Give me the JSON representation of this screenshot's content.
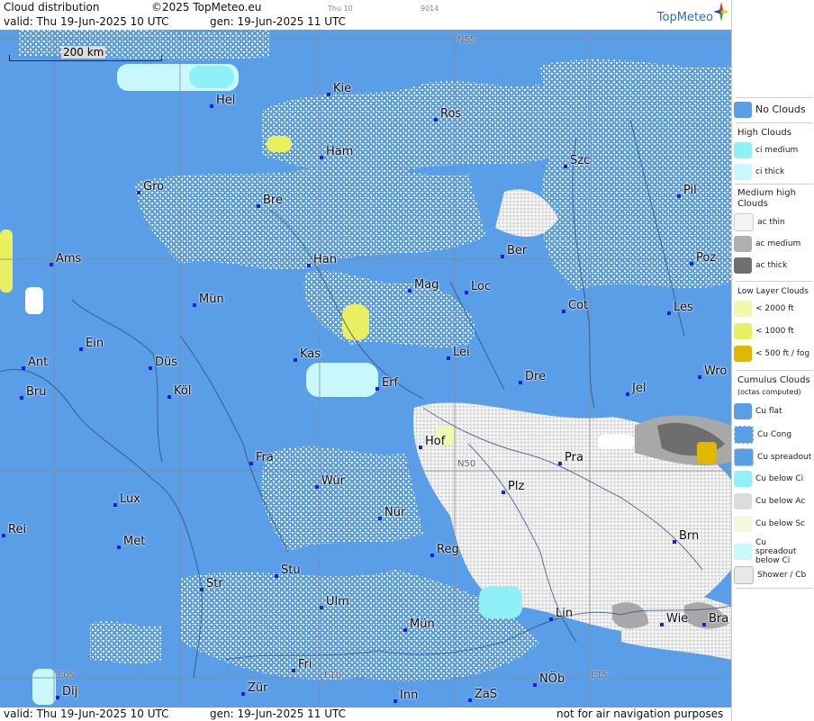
{
  "header": {
    "title": "Cloud distribution",
    "copyright": "©2025 TopMeteo.eu",
    "valid": "valid:  Thu  19-Jun-2025  10 UTC",
    "gen": "gen: 19-Jun-2025 11 UTC",
    "faint1": "Thu 10",
    "faint2": "9014",
    "brand": "TopMeteo"
  },
  "footer": {
    "valid": "valid:  Thu  19-Jun-2025  10 UTC",
    "gen": "gen: 19-Jun-2025 11 UTC",
    "note": "not for air navigation purposes"
  },
  "map": {
    "scale_label": "200 km",
    "grid_labels": [
      "N55",
      "N50",
      "E05",
      "E10",
      "E15"
    ],
    "cities": [
      {
        "name": "Kie"
      },
      {
        "name": "Hel"
      },
      {
        "name": "Ros"
      },
      {
        "name": "Ham"
      },
      {
        "name": "Szc"
      },
      {
        "name": "Gro"
      },
      {
        "name": "Bre"
      },
      {
        "name": "Pil"
      },
      {
        "name": "Ams"
      },
      {
        "name": "Han"
      },
      {
        "name": "Ber"
      },
      {
        "name": "Poz"
      },
      {
        "name": "Mün"
      },
      {
        "name": "Mag"
      },
      {
        "name": "Loc"
      },
      {
        "name": "Cot"
      },
      {
        "name": "Les"
      },
      {
        "name": "Ein"
      },
      {
        "name": "Kas"
      },
      {
        "name": "Lei"
      },
      {
        "name": "Ant"
      },
      {
        "name": "Düs"
      },
      {
        "name": "Dre"
      },
      {
        "name": "Wro"
      },
      {
        "name": "Erf"
      },
      {
        "name": "Bru"
      },
      {
        "name": "Köl"
      },
      {
        "name": "Jel"
      },
      {
        "name": "Hof"
      },
      {
        "name": "Fra"
      },
      {
        "name": "Pra"
      },
      {
        "name": "Wür"
      },
      {
        "name": "Lux"
      },
      {
        "name": "Plz"
      },
      {
        "name": "Rei"
      },
      {
        "name": "Nür"
      },
      {
        "name": "Met"
      },
      {
        "name": "Brn"
      },
      {
        "name": "Reg"
      },
      {
        "name": "Stu"
      },
      {
        "name": "Str"
      },
      {
        "name": "Ulm"
      },
      {
        "name": "Lin"
      },
      {
        "name": "Wie"
      },
      {
        "name": "Bra"
      },
      {
        "name": "Mün"
      },
      {
        "name": "Fri"
      },
      {
        "name": "NÖb"
      },
      {
        "name": "Dij"
      },
      {
        "name": "Zür"
      },
      {
        "name": "Inn"
      },
      {
        "name": "ZaS"
      }
    ]
  },
  "legend": {
    "no_clouds": "No Clouds",
    "high_clouds": "High Clouds",
    "ci_medium": "ci medium",
    "ci_thick": "ci thick",
    "medium_high": "Medium high Clouds",
    "ac_thin": "ac thin",
    "ac_medium": "ac medium",
    "ac_thick": "ac thick",
    "low_layer": "Low Layer Clouds",
    "low_2000": "< 2000 ft",
    "low_1000": "< 1000 ft",
    "low_500": "< 500 ft / fog",
    "cumulus": "Cumulus Clouds",
    "octas": "(octas computed)",
    "cu_flat": "Cu flat",
    "cu_cong": "Cu Cong",
    "cu_spread": "Cu spreadout",
    "cu_below_ci": "Cu below Ci",
    "cu_below_ac": "Cu below Ac",
    "cu_below_sc": "Cu below Sc",
    "cu_spread_ci": "Cu spreadout below Ci",
    "shower": "Shower / Cb",
    "colors": {
      "no_clouds": "#5b9ee8",
      "ci_medium": "#8ff0f8",
      "ci_thick": "#c8f8fc",
      "ac_thin": "#f4f4f4",
      "ac_medium": "#b0b0b0",
      "ac_thick": "#707070",
      "low_2000": "#f0f8b0",
      "low_1000": "#e8f060",
      "low_500": "#e0b800"
    }
  }
}
